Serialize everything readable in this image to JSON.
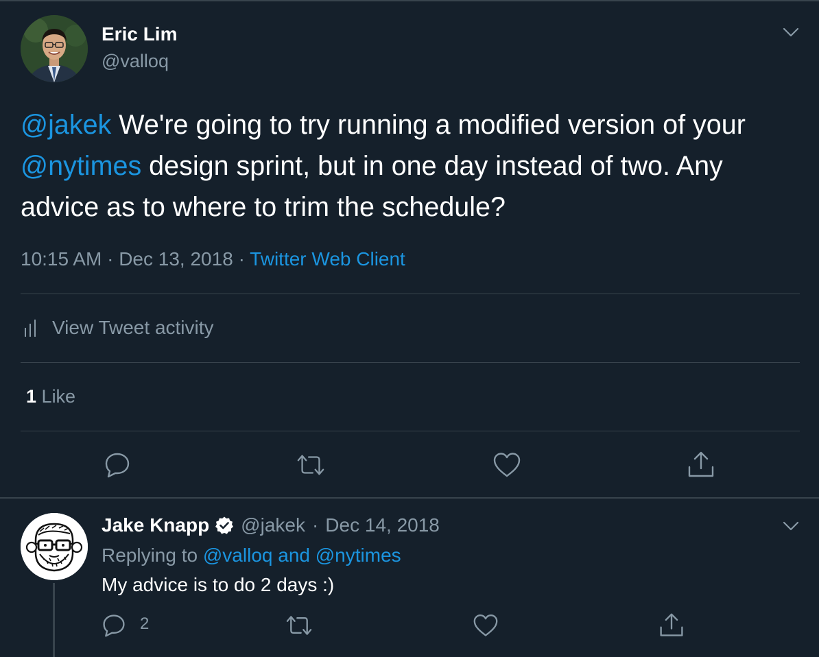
{
  "theme": {
    "background": "#15202b",
    "border": "#38444d",
    "muted": "#8899a6",
    "accent": "#1b95e0",
    "text": "#ffffff"
  },
  "main_tweet": {
    "author_name": "Eric Lim",
    "author_handle": "@valloq",
    "text": {
      "mention_1": "@jakek",
      "part_1": " We're going to try running a modified version of your ",
      "mention_2": "@nytimes",
      "part_2": " design sprint, but in one day instead of two. Any advice as to where to trim the schedule?"
    },
    "time": "10:15 AM",
    "date": "Dec 13, 2018",
    "separator": "·",
    "source": "Twitter Web Client",
    "activity_label": "View Tweet activity",
    "like_count": "1",
    "like_label": "Like",
    "menu_icon": "chevron-down-icon",
    "actions": [
      "reply-icon",
      "retweet-icon",
      "like-icon",
      "share-icon"
    ]
  },
  "reply_tweet": {
    "author_name": "Jake Knapp",
    "verified_icon": "verified-badge-icon",
    "author_handle": "@jakek",
    "separator": "·",
    "date": "Dec 14, 2018",
    "replying_prefix": "Replying to",
    "replying_to_1": "@valloq",
    "replying_and": "and",
    "replying_to_2": "@nytimes",
    "text": "My advice is to do 2 days :)",
    "reply_count": "2",
    "menu_icon": "chevron-down-icon",
    "actions": [
      "reply-icon",
      "retweet-icon",
      "like-icon",
      "share-icon"
    ]
  }
}
